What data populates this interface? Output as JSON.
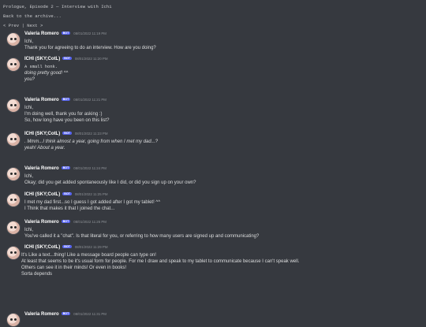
{
  "header": {
    "episode_title": "Prologue, Episode 2 — Interview with Ichi",
    "back_link": "Back to the archive...",
    "pager_open": "< ",
    "prev_label": "Prev",
    "pager_sep": " | ",
    "next_label": "Next",
    "pager_close": " >"
  },
  "messages": [
    {
      "author": "Valeria Romero",
      "badge": "BOT",
      "time": "08/01/2022 11:19 PM",
      "lines": [
        "Ichi,",
        "Thank you for agreeing to do an interview. How are you doing?"
      ]
    },
    {
      "author": "ICHI (SKY;CotL)",
      "badge": "BOT",
      "time": "08/01/2022 11:20 PM",
      "lines": [
        "A small honk.",
        "",
        "doing pretty good! ^^",
        "you?"
      ]
    },
    {
      "author": "Valeria Romero",
      "badge": "BOT",
      "time": "08/01/2022 11:21 PM",
      "lines": [
        "Ichi,",
        "I'm doing well, thank you for asking :)",
        "So, how long have you been on this list?"
      ]
    },
    {
      "author": "ICHI (SKY;CotL)",
      "badge": "BOT",
      "time": "08/01/2022 11:23 PM",
      "lines": [
        ". Mmm...I think almost a year, going from when I met my dad...?",
        "",
        "",
        "yeah! About a year."
      ]
    },
    {
      "author": "Valeria Romero",
      "badge": "BOT",
      "time": "08/01/2022 11:24 PM",
      "lines": [
        "Ichi,",
        "Okay; did you get added spontaneously like I did, or did you sign up on your own?"
      ]
    },
    {
      "author": "ICHI (SKY;CotL)",
      "badge": "BOT",
      "time": "08/01/2022 11:25 PM",
      "lines": [
        "I met my dad first...so I guess I got added after I got my tablet! ^^",
        "I Think that makes it that I joined the chat..."
      ]
    },
    {
      "author": "Valeria Romero",
      "badge": "BOT",
      "time": "08/01/2022 11:26 PM",
      "lines": [
        "Ichi,",
        "You've called it a \"chat\". Is that literal for you, or referring to how many users are signed up and communicating?"
      ]
    },
    {
      "author": "ICHI (SKY;CotL)",
      "badge": "BOT",
      "time": "08/01/2022 11:29 PM",
      "lines": [
        "It's Like a text...thing! Like a message board people can type on!",
        "",
        "At least that seems to be it's usual form for people. For me I draw and speak to my tablet to communicate because I can't speak well.",
        "",
        "Others can see it in their minds! Or even in books!",
        "",
        "",
        "Sorta depends"
      ]
    },
    {
      "author": "Valeria Romero",
      "badge": "BOT",
      "time": "08/01/2022 11:31 PM",
      "lines": []
    }
  ]
}
